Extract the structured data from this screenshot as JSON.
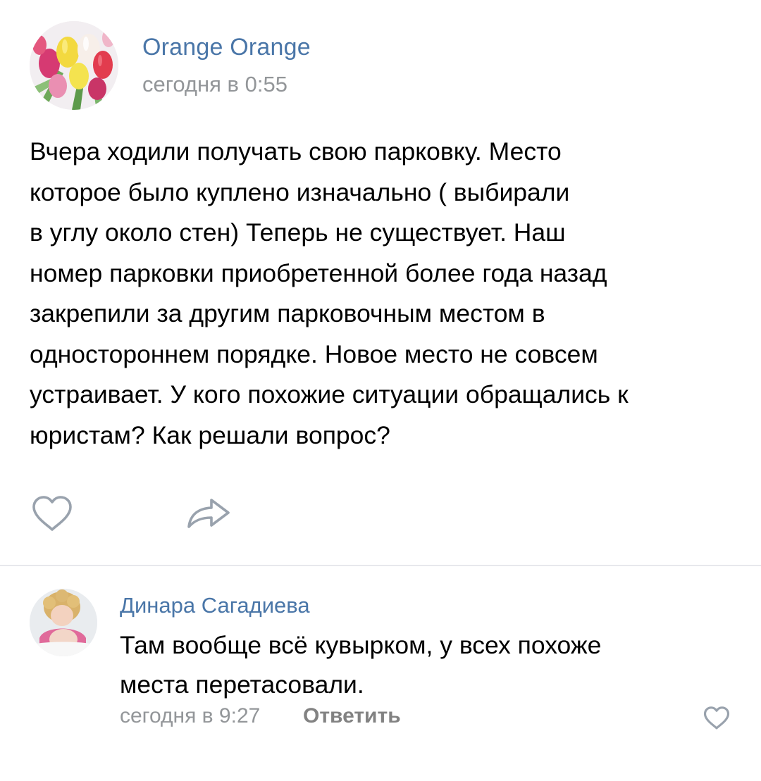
{
  "post": {
    "author": "Orange Orange",
    "time": "сегодня в 0:55",
    "text_lines": [
      "Вчера ходили получать свою парковку. Место",
      "которое было куплено изначально ( выбирали",
      "в углу около стен) Теперь не существует. Наш",
      "номер парковки приобретенной более года назад",
      "закрепили за другим парковочным местом в",
      "одностороннем порядке. Новое место не совсем",
      "устраивает. У кого похожие ситуации обращались к",
      "юристам? Как решали вопрос?"
    ],
    "actions": {
      "like_icon": "heart-outline-icon",
      "share_icon": "share-arrow-icon"
    }
  },
  "comment": {
    "author": "Динара Сагадиева",
    "text_lines": [
      "Там вообще всё кувырком, у всех похоже",
      "места перетасовали."
    ],
    "time": "сегодня в 9:27",
    "reply_label": "Ответить",
    "like_icon": "heart-outline-icon"
  },
  "colors": {
    "link": "#4a76a8",
    "muted": "#939699",
    "icon": "#99a2ad",
    "divider": "#e7e8ec"
  }
}
